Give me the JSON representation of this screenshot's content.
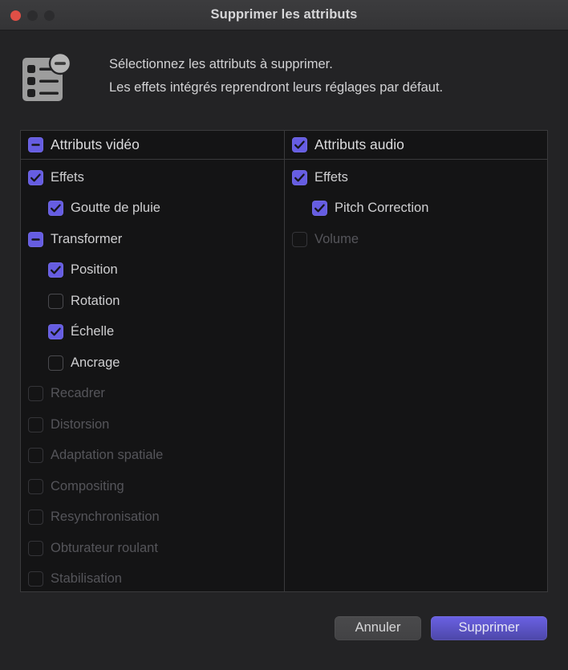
{
  "window": {
    "title": "Supprimer les attributs",
    "traffic_lights": {
      "close": "close-button",
      "minimize": "minimize-button",
      "maximize": "maximize-button"
    }
  },
  "header": {
    "icon": "remove-attributes-icon",
    "message_line1": "Sélectionnez les attributs à supprimer.",
    "message_line2": "Les effets intégrés reprendront leurs réglages par défaut."
  },
  "colors": {
    "accent": "#665de2",
    "window_bg": "#232325",
    "panel_bg": "#141415",
    "panel_border": "#3a3a3c",
    "label": "#cfcfd1",
    "label_disabled": "#55555a",
    "close_light": "#df4f46"
  },
  "panel": {
    "columns": [
      {
        "header": {
          "label": "Attributs vidéo",
          "state": "mixed",
          "disabled": false
        },
        "rows": [
          {
            "label": "Effets",
            "state": "on",
            "indent": 0,
            "disabled": false
          },
          {
            "label": "Goutte de pluie",
            "state": "on",
            "indent": 1,
            "disabled": false
          },
          {
            "label": "Transformer",
            "state": "mixed",
            "indent": 0,
            "disabled": false
          },
          {
            "label": "Position",
            "state": "on",
            "indent": 1,
            "disabled": false
          },
          {
            "label": "Rotation",
            "state": "off",
            "indent": 1,
            "disabled": false
          },
          {
            "label": "Échelle",
            "state": "on",
            "indent": 1,
            "disabled": false
          },
          {
            "label": "Ancrage",
            "state": "off",
            "indent": 1,
            "disabled": false
          },
          {
            "label": "Recadrer",
            "state": "off",
            "indent": 0,
            "disabled": true
          },
          {
            "label": "Distorsion",
            "state": "off",
            "indent": 0,
            "disabled": true
          },
          {
            "label": "Adaptation spatiale",
            "state": "off",
            "indent": 0,
            "disabled": true
          },
          {
            "label": "Compositing",
            "state": "off",
            "indent": 0,
            "disabled": true
          },
          {
            "label": "Resynchronisation",
            "state": "off",
            "indent": 0,
            "disabled": true
          },
          {
            "label": "Obturateur roulant",
            "state": "off",
            "indent": 0,
            "disabled": true
          },
          {
            "label": "Stabilisation",
            "state": "off",
            "indent": 0,
            "disabled": true
          }
        ]
      },
      {
        "header": {
          "label": "Attributs audio",
          "state": "on",
          "disabled": false
        },
        "rows": [
          {
            "label": "Effets",
            "state": "on",
            "indent": 0,
            "disabled": false
          },
          {
            "label": "Pitch Correction",
            "state": "on",
            "indent": 1,
            "disabled": false
          },
          {
            "label": "Volume",
            "state": "off",
            "indent": 0,
            "disabled": true
          }
        ]
      }
    ]
  },
  "footer": {
    "cancel_label": "Annuler",
    "confirm_label": "Supprimer"
  }
}
